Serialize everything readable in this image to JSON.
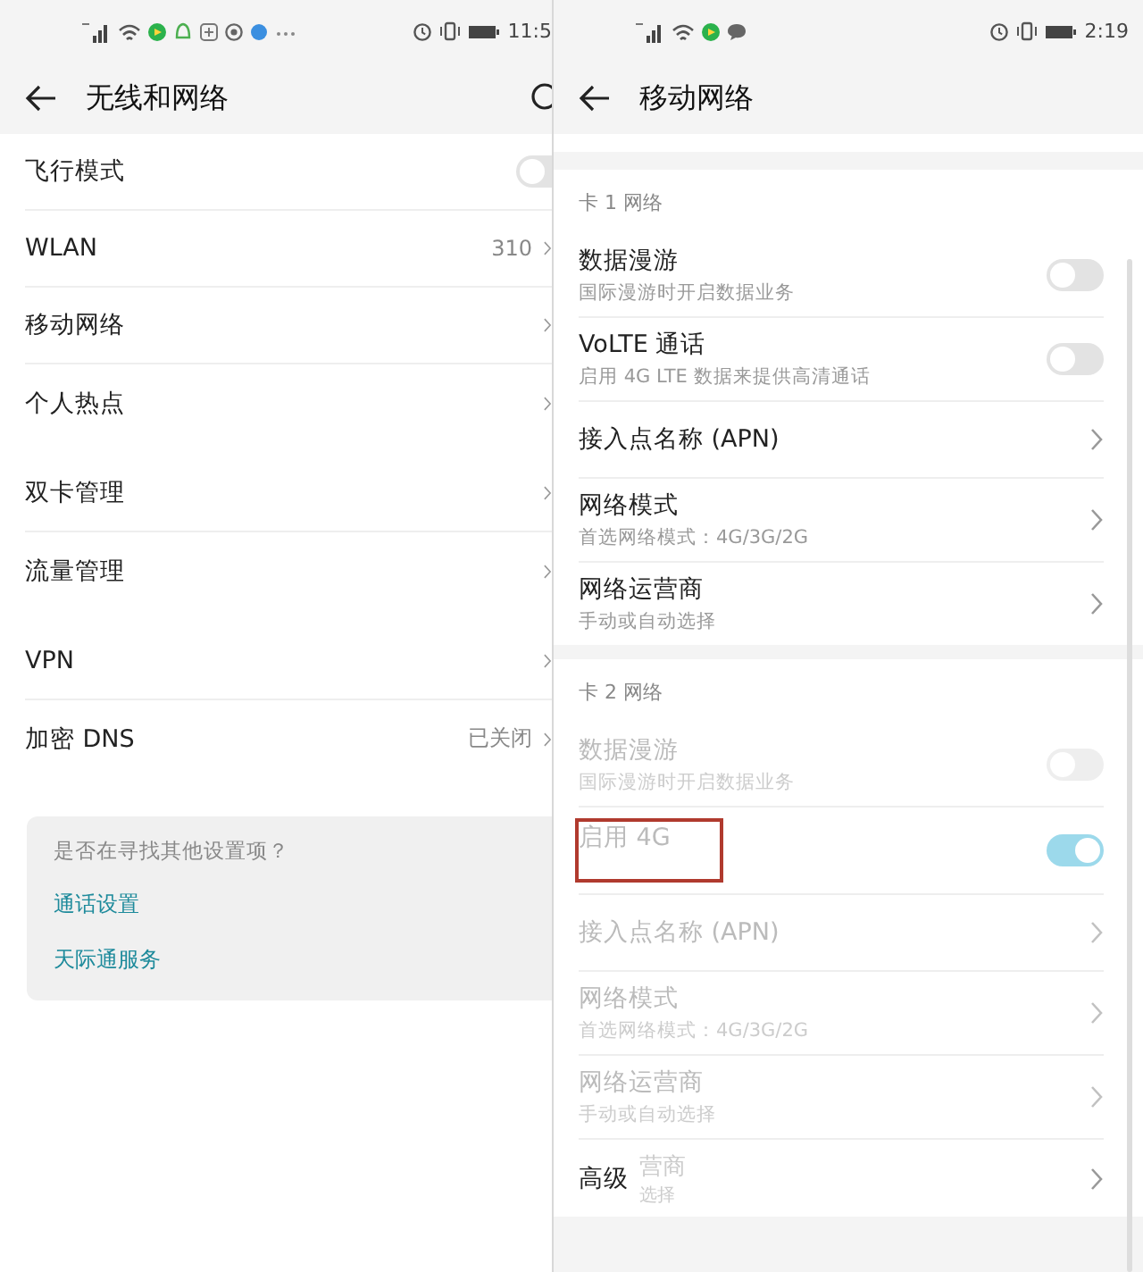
{
  "panels": [
    {
      "status_bar": {
        "time": "11:5",
        "kind": "busy"
      },
      "header": {
        "title": "无线和网络",
        "has_search": true
      },
      "clipped_right": true,
      "groups": [
        {
          "items": [
            {
              "title": "飞行模式",
              "kind": "toggle",
              "on": false,
              "disabled": false
            },
            {
              "title": "WLAN",
              "value": "310",
              "kind": "link",
              "disabled": false
            },
            {
              "title": "移动网络",
              "kind": "link",
              "disabled": false
            },
            {
              "title": "个人热点",
              "kind": "link",
              "disabled": false
            }
          ]
        },
        {
          "items": [
            {
              "title": "双卡管理",
              "kind": "link",
              "disabled": false
            },
            {
              "title": "流量管理",
              "kind": "link",
              "disabled": false
            }
          ]
        },
        {
          "items": [
            {
              "title": "VPN",
              "kind": "link",
              "disabled": false
            },
            {
              "title": "加密 DNS",
              "value": "已关闭",
              "kind": "link",
              "disabled": false
            }
          ]
        }
      ],
      "suggestion": {
        "prompt": "是否在寻找其他设置项？",
        "links": [
          "通话设置",
          "天际通服务"
        ]
      }
    },
    {
      "status_bar": {
        "time": "2:19",
        "kind": "quiet"
      },
      "header": {
        "title": "移动网络",
        "has_search": false
      },
      "clipped_right": false,
      "scrollbar": true,
      "groups": [
        {
          "label": "卡 1 网络",
          "items": [
            {
              "title": "数据漫游",
              "subtitle": "国际漫游时开启数据业务",
              "kind": "toggle",
              "on": false,
              "disabled": false
            },
            {
              "title": "VoLTE 通话",
              "subtitle": "启用 4G LTE 数据来提供高清通话",
              "kind": "toggle",
              "on": false,
              "disabled": false
            },
            {
              "title": "接入点名称 (APN)",
              "kind": "link",
              "disabled": false
            },
            {
              "title": "网络模式",
              "subtitle": "首选网络模式：4G/3G/2G",
              "kind": "link",
              "disabled": false
            },
            {
              "title": "网络运营商",
              "subtitle": "手动或自动选择",
              "kind": "link",
              "disabled": false
            }
          ]
        },
        {
          "label": "卡 2 网络",
          "items": [
            {
              "title": "数据漫游",
              "subtitle": "国际漫游时开启数据业务",
              "kind": "toggle",
              "on": false,
              "disabled": true
            },
            {
              "title": "启用 4G",
              "kind": "toggle",
              "on": true,
              "disabled": true,
              "highlighted": true
            },
            {
              "title": "接入点名称 (APN)",
              "kind": "link",
              "disabled": true
            },
            {
              "title": "网络模式",
              "subtitle": "首选网络模式：4G/3G/2G",
              "kind": "link",
              "disabled": true
            },
            {
              "title": "网络运营商",
              "subtitle": "手动或自动选择",
              "kind": "link",
              "disabled": true
            },
            {
              "title": "高级",
              "ghost_title": "营商",
              "ghost_subtitle": "选择",
              "kind": "link",
              "disabled": false
            }
          ]
        }
      ]
    }
  ]
}
